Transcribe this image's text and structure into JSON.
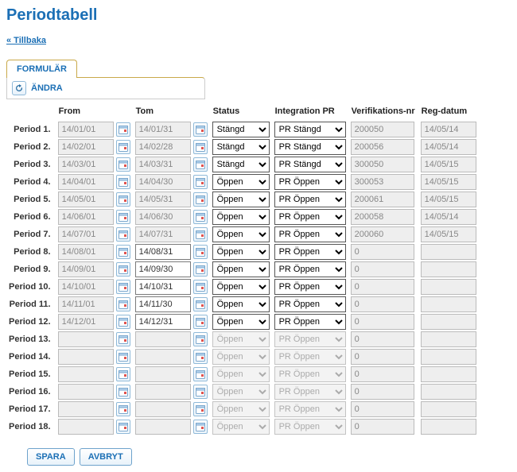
{
  "page_title": "Periodtabell",
  "back_link": "« Tillbaka",
  "tab": {
    "formular": "FORMULÄR"
  },
  "toolbar": {
    "title": "ÄNDRA"
  },
  "headers": {
    "from": "From",
    "tom": "Tom",
    "status": "Status",
    "integration": "Integration PR",
    "verif": "Verifikations-nr",
    "regdatum": "Reg-datum"
  },
  "status_options": [
    "Stängd",
    "Öppen"
  ],
  "integration_options": [
    "PR Stängd",
    "PR Öppen"
  ],
  "buttons": {
    "save": "SPARA",
    "cancel": "AVBRYT"
  },
  "rows": [
    {
      "label": "Period 1.",
      "from": "14/01/01",
      "tom": "14/01/31",
      "from_edit": false,
      "tom_edit": false,
      "status": "Stängd",
      "integration": "PR Stängd",
      "verif": "200050",
      "regdatum": "14/05/14",
      "active": true
    },
    {
      "label": "Period 2.",
      "from": "14/02/01",
      "tom": "14/02/28",
      "from_edit": false,
      "tom_edit": false,
      "status": "Stängd",
      "integration": "PR Stängd",
      "verif": "200056",
      "regdatum": "14/05/14",
      "active": true
    },
    {
      "label": "Period 3.",
      "from": "14/03/01",
      "tom": "14/03/31",
      "from_edit": false,
      "tom_edit": false,
      "status": "Stängd",
      "integration": "PR Stängd",
      "verif": "300050",
      "regdatum": "14/05/15",
      "active": true
    },
    {
      "label": "Period 4.",
      "from": "14/04/01",
      "tom": "14/04/30",
      "from_edit": false,
      "tom_edit": false,
      "status": "Öppen",
      "integration": "PR Öppen",
      "verif": "300053",
      "regdatum": "14/05/15",
      "active": true
    },
    {
      "label": "Period 5.",
      "from": "14/05/01",
      "tom": "14/05/31",
      "from_edit": false,
      "tom_edit": false,
      "status": "Öppen",
      "integration": "PR Öppen",
      "verif": "200061",
      "regdatum": "14/05/15",
      "active": true
    },
    {
      "label": "Period 6.",
      "from": "14/06/01",
      "tom": "14/06/30",
      "from_edit": false,
      "tom_edit": false,
      "status": "Öppen",
      "integration": "PR Öppen",
      "verif": "200058",
      "regdatum": "14/05/14",
      "active": true
    },
    {
      "label": "Period 7.",
      "from": "14/07/01",
      "tom": "14/07/31",
      "from_edit": false,
      "tom_edit": false,
      "status": "Öppen",
      "integration": "PR Öppen",
      "verif": "200060",
      "regdatum": "14/05/15",
      "active": true
    },
    {
      "label": "Period 8.",
      "from": "14/08/01",
      "tom": "14/08/31",
      "from_edit": false,
      "tom_edit": true,
      "status": "Öppen",
      "integration": "PR Öppen",
      "verif": "0",
      "regdatum": "",
      "active": true
    },
    {
      "label": "Period 9.",
      "from": "14/09/01",
      "tom": "14/09/30",
      "from_edit": false,
      "tom_edit": true,
      "status": "Öppen",
      "integration": "PR Öppen",
      "verif": "0",
      "regdatum": "",
      "active": true
    },
    {
      "label": "Period 10.",
      "from": "14/10/01",
      "tom": "14/10/31",
      "from_edit": false,
      "tom_edit": true,
      "status": "Öppen",
      "integration": "PR Öppen",
      "verif": "0",
      "regdatum": "",
      "active": true
    },
    {
      "label": "Period 11.",
      "from": "14/11/01",
      "tom": "14/11/30",
      "from_edit": false,
      "tom_edit": true,
      "status": "Öppen",
      "integration": "PR Öppen",
      "verif": "0",
      "regdatum": "",
      "active": true
    },
    {
      "label": "Period 12.",
      "from": "14/12/01",
      "tom": "14/12/31",
      "from_edit": false,
      "tom_edit": true,
      "status": "Öppen",
      "integration": "PR Öppen",
      "verif": "0",
      "regdatum": "",
      "active": true
    },
    {
      "label": "Period 13.",
      "from": "",
      "tom": "",
      "from_edit": false,
      "tom_edit": false,
      "status": "Öppen",
      "integration": "PR Öppen",
      "verif": "0",
      "regdatum": "",
      "active": false
    },
    {
      "label": "Period 14.",
      "from": "",
      "tom": "",
      "from_edit": false,
      "tom_edit": false,
      "status": "Öppen",
      "integration": "PR Öppen",
      "verif": "0",
      "regdatum": "",
      "active": false
    },
    {
      "label": "Period 15.",
      "from": "",
      "tom": "",
      "from_edit": false,
      "tom_edit": false,
      "status": "Öppen",
      "integration": "PR Öppen",
      "verif": "0",
      "regdatum": "",
      "active": false
    },
    {
      "label": "Period 16.",
      "from": "",
      "tom": "",
      "from_edit": false,
      "tom_edit": false,
      "status": "Öppen",
      "integration": "PR Öppen",
      "verif": "0",
      "regdatum": "",
      "active": false
    },
    {
      "label": "Period 17.",
      "from": "",
      "tom": "",
      "from_edit": false,
      "tom_edit": false,
      "status": "Öppen",
      "integration": "PR Öppen",
      "verif": "0",
      "regdatum": "",
      "active": false
    },
    {
      "label": "Period 18.",
      "from": "",
      "tom": "",
      "from_edit": false,
      "tom_edit": false,
      "status": "Öppen",
      "integration": "PR Öppen",
      "verif": "0",
      "regdatum": "",
      "active": false
    }
  ]
}
